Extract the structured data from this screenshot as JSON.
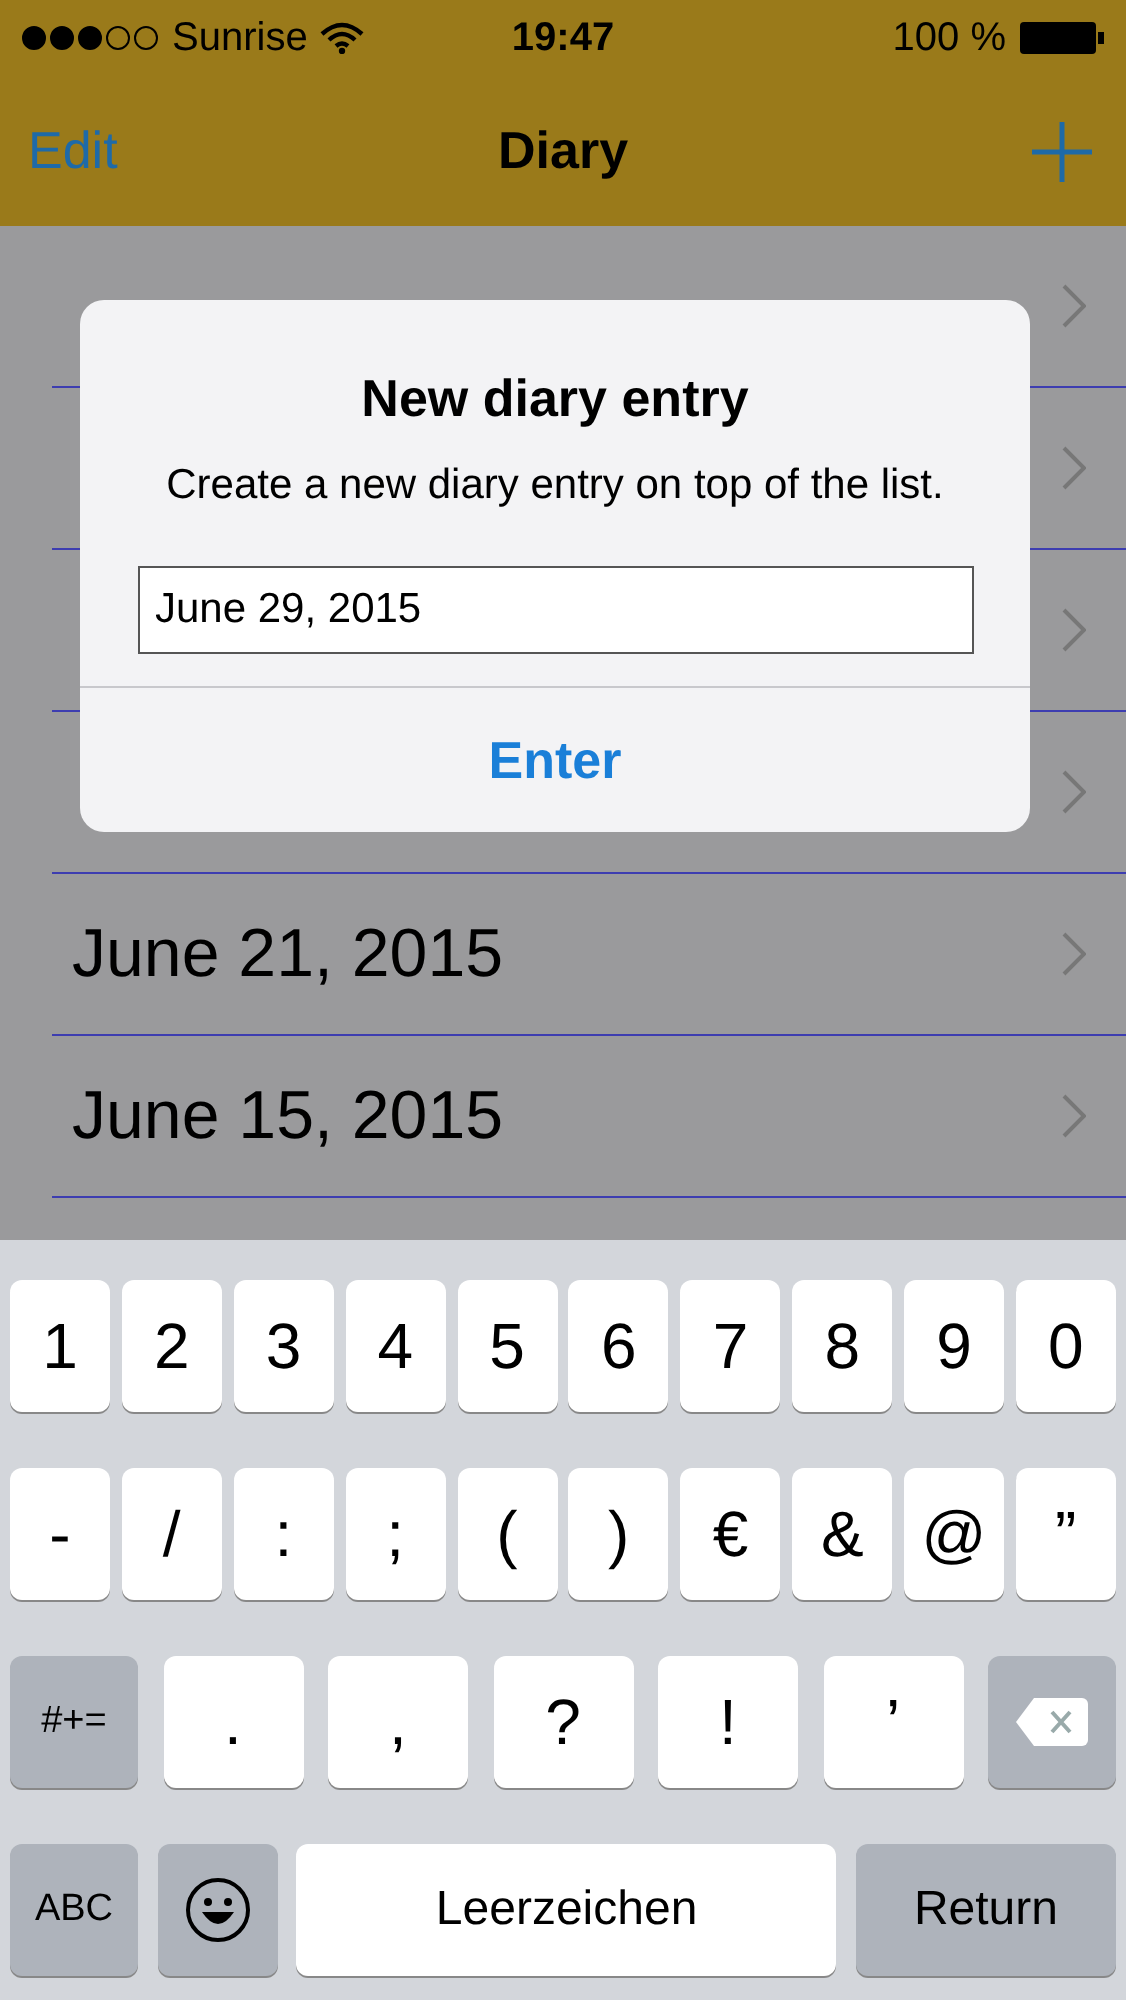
{
  "status_bar": {
    "carrier": "Sunrise",
    "time": "19:47",
    "battery": "100 %"
  },
  "nav": {
    "left": "Edit",
    "title": "Diary"
  },
  "rows": [
    {},
    {},
    {},
    {},
    {
      "label": "June 21, 2015"
    },
    {
      "label": "June 15, 2015"
    }
  ],
  "dialog": {
    "title": "New diary entry",
    "message": "Create a new diary entry on top of the list.",
    "field": {
      "value": "June 29, 2015"
    },
    "button": "Enter"
  },
  "keyboard": {
    "rows": [
      {
        "keys": [
          {
            "kind": "char",
            "label": "1"
          },
          {
            "kind": "char",
            "label": "2"
          },
          {
            "kind": "char",
            "label": "3"
          },
          {
            "kind": "char",
            "label": "4"
          },
          {
            "kind": "char",
            "label": "5"
          },
          {
            "kind": "char",
            "label": "6"
          },
          {
            "kind": "char",
            "label": "7"
          },
          {
            "kind": "char",
            "label": "8"
          },
          {
            "kind": "char",
            "label": "9"
          },
          {
            "kind": "char",
            "label": "0"
          }
        ]
      },
      {
        "keys": [
          {
            "kind": "char",
            "label": "-"
          },
          {
            "kind": "char",
            "label": "/"
          },
          {
            "kind": "char",
            "label": ":"
          },
          {
            "kind": "char",
            "label": ";"
          },
          {
            "kind": "char",
            "label": "("
          },
          {
            "kind": "char",
            "label": ")"
          },
          {
            "kind": "char",
            "label": "€"
          },
          {
            "kind": "char",
            "label": "&"
          },
          {
            "kind": "char",
            "label": "@"
          },
          {
            "kind": "char",
            "label": "”"
          }
        ]
      },
      {
        "keys": [
          {
            "kind": "function",
            "label": "#+="
          },
          {
            "kind": "wide",
            "label": "."
          },
          {
            "kind": "wide",
            "label": ","
          },
          {
            "kind": "wide",
            "label": "?"
          },
          {
            "kind": "wide",
            "label": "!"
          },
          {
            "kind": "wide",
            "label": "’"
          },
          {
            "kind": "delete"
          }
        ]
      },
      {
        "keys": [
          {
            "kind": "function",
            "label": "ABC"
          },
          {
            "kind": "emoji"
          },
          {
            "kind": "space",
            "label": "Leerzeichen"
          },
          {
            "kind": "return",
            "label": "Return"
          }
        ]
      }
    ]
  }
}
